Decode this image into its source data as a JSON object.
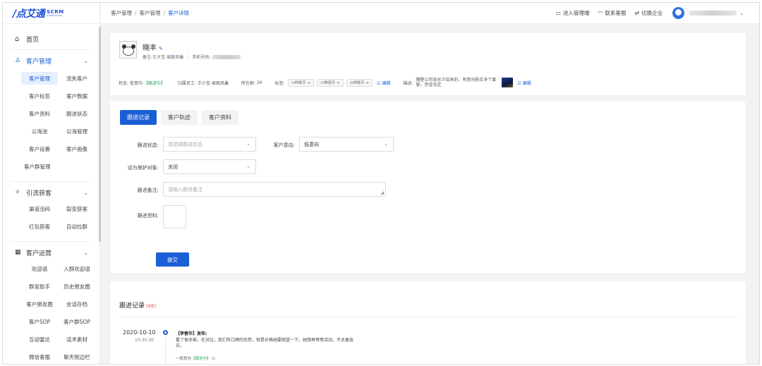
{
  "brand": {
    "logo_text": "/点艾通",
    "scrm": "SCRM",
    "scrm_sub": "DIANAITONG"
  },
  "header": {
    "breadcrumb": [
      "客户管理",
      "客户管理",
      "客户详情"
    ],
    "actions": [
      {
        "icon": "monitor-icon",
        "label": "进入管理端"
      },
      {
        "icon": "headset-icon",
        "label": "联系客服"
      },
      {
        "icon": "switch-icon",
        "label": "切换企业"
      }
    ]
  },
  "sidebar": {
    "home": "首页",
    "groups": [
      {
        "label": "客户管理",
        "icon": "user-icon",
        "items": [
          "客户管理",
          "流失客户",
          "客户标签",
          "客户数据",
          "客户资料",
          "跟进状态",
          "公海池",
          "公海管理",
          "客户设置",
          "客户画像"
        ],
        "single": "客户群管理"
      },
      {
        "label": "引流获客",
        "icon": "share-icon",
        "items": [
          "渠道活码",
          "裂变获客",
          "红包获客",
          "自动拉群"
        ]
      },
      {
        "label": "客户运营",
        "icon": "grid-icon",
        "items": [
          "欢迎语",
          "入群欢迎语",
          "群发助手",
          "历史朋友圈",
          "客户朋友圈",
          "会话存档",
          "客户SOP",
          "客户群SOP",
          "互动雷达",
          "话术素材",
          "微信客服",
          "聊天侧边栏"
        ]
      }
    ]
  },
  "customer": {
    "name": "晓丰",
    "remark_label": "备注:",
    "remark": "王大宝-易联凤巢",
    "phone_label": "手机号码:",
    "status_label": "状态:",
    "status_value": "低意向",
    "status_tag": "【跟进中】",
    "owner_label": "归属员工:",
    "owner": "王小宝-易联凤巢",
    "groups_label": "所在群:",
    "groups_count": "20",
    "tags_label": "标签:",
    "tags": [
      "⊙林晓平 ×",
      "⊙林晓平 ×",
      "⊙林晓平 ×"
    ],
    "edit_label": "编辑",
    "desc_label": "描述:",
    "desc": "隔壁公司张总介绍来的，有意向购买多个套餐，资金充足",
    "desc_edit": "编辑"
  },
  "form": {
    "tabs": [
      "跟进记录",
      "客户轨迹",
      "客户资料"
    ],
    "status_label": "跟进状态:",
    "status_placeholder": "请选择跟进状态",
    "intent_label": "客户意向:",
    "intent_value": "低意向",
    "protect_label": "设为保护对象:",
    "protect_value": "关闭",
    "note_label": "跟进备注:",
    "note_placeholder": "请输入跟进备注",
    "file_label": "跟进资料:",
    "submit": "提交"
  },
  "records": {
    "title": "跟进记录",
    "count": "(8条)",
    "items": [
      {
        "date": "2020-10-10",
        "time": "10:30:30",
        "author": "【李春华】发布:",
        "body": "看了很多家，在对比，我们有口碑的优势，但是价格她要观望一下，她想再等等活动，不太着急买。",
        "meta": "一般意向【跟进中】"
      }
    ]
  }
}
